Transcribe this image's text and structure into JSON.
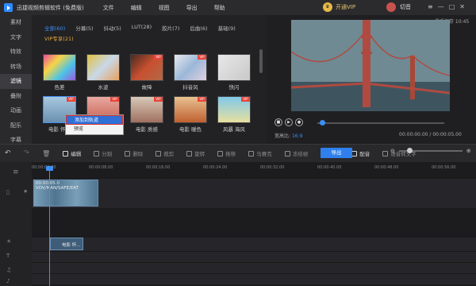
{
  "app": {
    "title": "迅捷视频剪辑软件 (免费版)"
  },
  "menu": [
    "文件",
    "编辑",
    "视图",
    "导出",
    "帮助"
  ],
  "vip": "开通VIP",
  "user": "切音",
  "window_buttons": [
    "≡",
    "—",
    "□",
    "✕"
  ],
  "save_hint": "最近保存 10:45",
  "sidebar": [
    "素材",
    "文字",
    "特效",
    "转场",
    "滤镜",
    "叠附",
    "动画",
    "配乐",
    "字幕"
  ],
  "filter_tabs": [
    "全部(60)",
    "分幕(5)",
    "抖动(5)",
    "LUT(28)",
    "胶片(7)",
    "后曲(6)",
    "基础(9)"
  ],
  "vip_tab": "VIP专享(21)",
  "filters": [
    {
      "label": "色差",
      "vip": false
    },
    {
      "label": "水波",
      "vip": false
    },
    {
      "label": "故障",
      "vip": true
    },
    {
      "label": "抖音风",
      "vip": true
    },
    {
      "label": "快闪",
      "vip": false
    },
    {
      "label": "电影 怀…",
      "vip": true
    },
    {
      "label": "",
      "vip": true
    },
    {
      "label": "电影 质感",
      "vip": true
    },
    {
      "label": "电影 暖色",
      "vip": true
    },
    {
      "label": "风暴 海风",
      "vip": true
    }
  ],
  "context_menu": [
    "添加到轨道",
    "预览"
  ],
  "player": {
    "ratio_label": "宽高比:",
    "ratio": "16:9",
    "time": "00:00:00.00 / 00:00:05.00"
  },
  "toolbar": [
    "编辑",
    "分割",
    "删除",
    "裁剪",
    "旋转",
    "拖移",
    "马赛克",
    "冻结帧",
    "时长",
    "配音",
    "语音转文字"
  ],
  "toolbar_enabled": [
    "编辑",
    "时长",
    "配音"
  ],
  "export_label": "导出",
  "ruler": [
    "00:00:00.00",
    "00:00:08.00",
    "00:00:16.00",
    "00:00:24.00",
    "00:00:32.00",
    "00:00:40.00",
    "00:00:48.00",
    "00:00:56.00",
    "00:01:04.00",
    "00:01:12.00"
  ],
  "clips": {
    "video": "00:00:05.0 VOV/MAN/SAFE/EAT",
    "filter": "电影 怀…"
  },
  "colors": {
    "accent": "#3d8ff5",
    "vip": "#e8b846",
    "export": "#2f80ed"
  }
}
